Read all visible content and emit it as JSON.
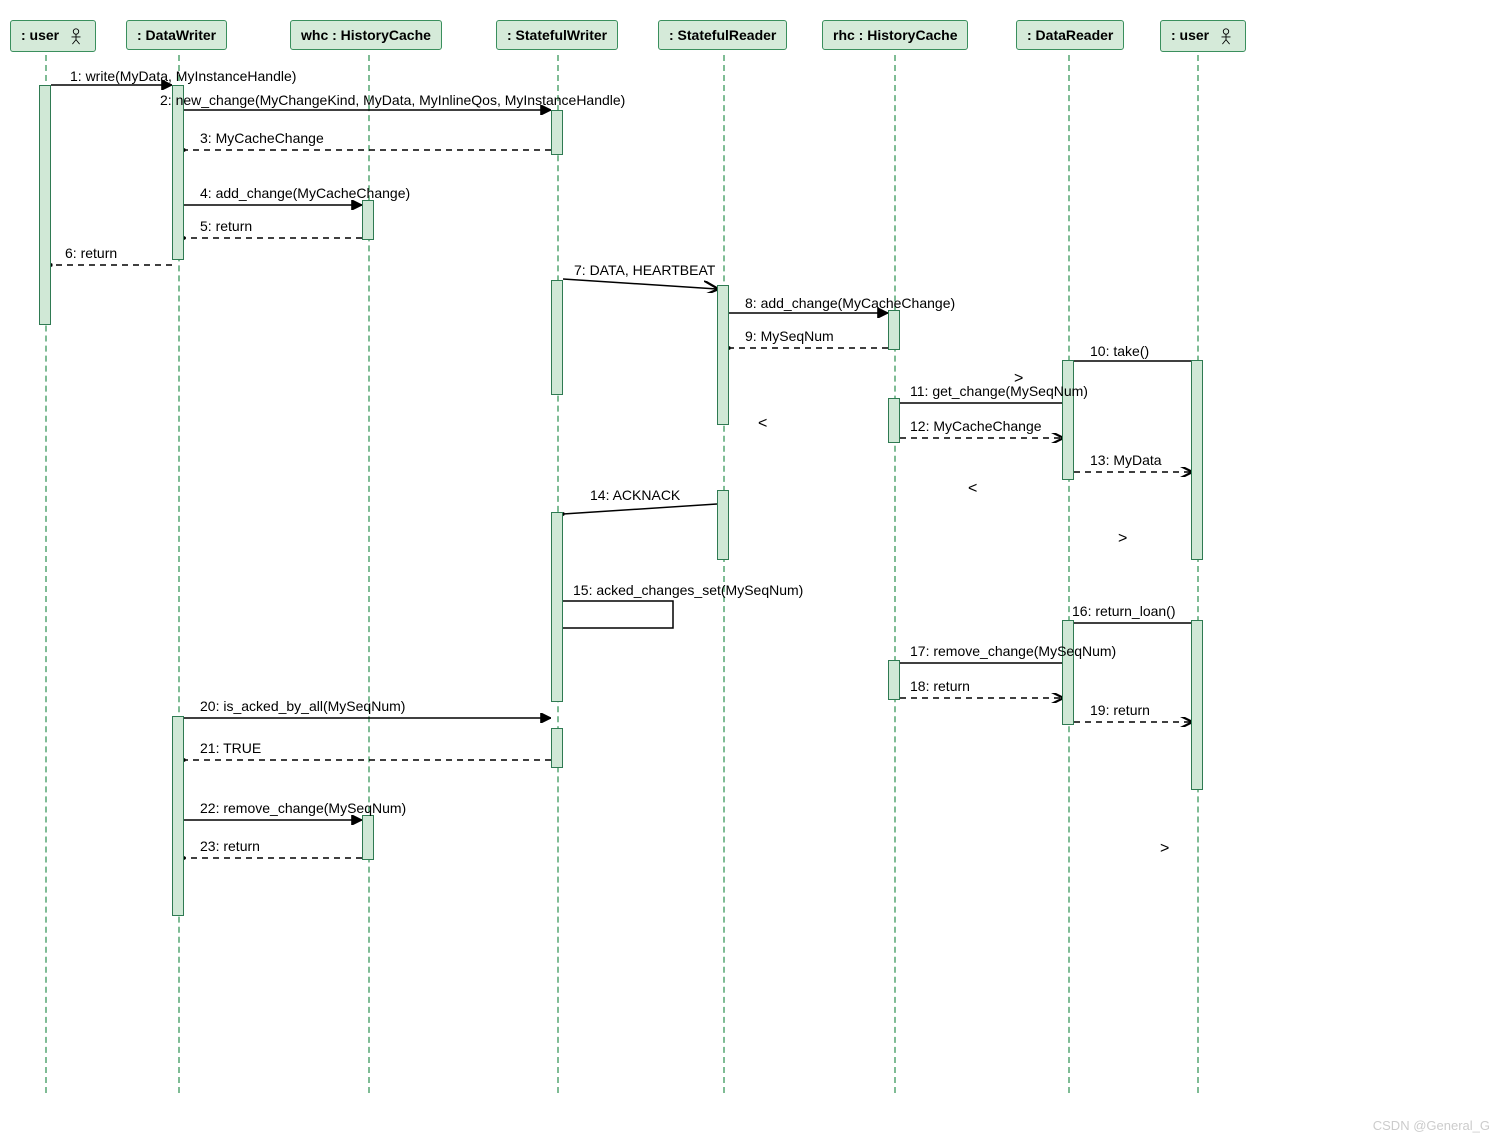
{
  "participants": {
    "user1": ": user",
    "dataWriter": ": DataWriter",
    "whc": "whc : HistoryCache",
    "statefulWriter": ": StatefulWriter",
    "statefulReader": ": StatefulReader",
    "rhc": "rhc : HistoryCache",
    "dataReader": ": DataReader",
    "user2": ": user"
  },
  "messages": {
    "m1": "1: write(MyData, MyInstanceHandle)",
    "m2": "2: new_change(MyChangeKind, MyData, MyInlineQos, MyInstanceHandle)",
    "m3": "3: MyCacheChange",
    "m4": "4: add_change(MyCacheChange)",
    "m5": "5: return",
    "m6": "6: return",
    "m7": "7: DATA, HEARTBEAT",
    "m8": "8: add_change(MyCacheChange)",
    "m9": "9: MySeqNum",
    "m10": "10: take()",
    "m11": "11: get_change(MySeqNum)",
    "m12": "12: MyCacheChange",
    "m13": "13: MyData",
    "m14": "14: ACKNACK",
    "m15": "15: acked_changes_set(MySeqNum)",
    "m16": "16: return_loan()",
    "m17": "17: remove_change(MySeqNum)",
    "m18": "18: return",
    "m19": "19: return",
    "m20": "20: is_acked_by_all(MySeqNum)",
    "m21": "21: TRUE",
    "m22": "22: remove_change(MySeqNum)",
    "m23": "23: return"
  },
  "watermark": "CSDN @General_G",
  "chart_data": {
    "type": "sequence-diagram",
    "participants": [
      {
        "id": "user1",
        "label": ": user",
        "kind": "actor"
      },
      {
        "id": "dataWriter",
        "label": ": DataWriter",
        "kind": "object"
      },
      {
        "id": "whc",
        "label": "whc : HistoryCache",
        "kind": "object"
      },
      {
        "id": "statefulWriter",
        "label": ": StatefulWriter",
        "kind": "object"
      },
      {
        "id": "statefulReader",
        "label": ": StatefulReader",
        "kind": "object"
      },
      {
        "id": "rhc",
        "label": "rhc : HistoryCache",
        "kind": "object"
      },
      {
        "id": "dataReader",
        "label": ": DataReader",
        "kind": "object"
      },
      {
        "id": "user2",
        "label": ": user",
        "kind": "actor"
      }
    ],
    "messages": [
      {
        "n": 1,
        "from": "user1",
        "to": "dataWriter",
        "label": "write(MyData, MyInstanceHandle)",
        "style": "sync"
      },
      {
        "n": 2,
        "from": "dataWriter",
        "to": "statefulWriter",
        "label": "new_change(MyChangeKind, MyData, MyInlineQos, MyInstanceHandle)",
        "style": "sync"
      },
      {
        "n": 3,
        "from": "statefulWriter",
        "to": "dataWriter",
        "label": "MyCacheChange",
        "style": "return"
      },
      {
        "n": 4,
        "from": "dataWriter",
        "to": "whc",
        "label": "add_change(MyCacheChange)",
        "style": "sync"
      },
      {
        "n": 5,
        "from": "whc",
        "to": "dataWriter",
        "label": "return",
        "style": "return"
      },
      {
        "n": 6,
        "from": "dataWriter",
        "to": "user1",
        "label": "return",
        "style": "return"
      },
      {
        "n": 7,
        "from": "statefulWriter",
        "to": "statefulReader",
        "label": "DATA, HEARTBEAT",
        "style": "async"
      },
      {
        "n": 8,
        "from": "statefulReader",
        "to": "rhc",
        "label": "add_change(MyCacheChange)",
        "style": "sync"
      },
      {
        "n": 9,
        "from": "rhc",
        "to": "statefulReader",
        "label": "MySeqNum",
        "style": "return"
      },
      {
        "n": 10,
        "from": "user2",
        "to": "dataReader",
        "label": "take()",
        "style": "sync"
      },
      {
        "n": 11,
        "from": "dataReader",
        "to": "rhc",
        "label": "get_change(MySeqNum)",
        "style": "sync"
      },
      {
        "n": 12,
        "from": "rhc",
        "to": "dataReader",
        "label": "MyCacheChange",
        "style": "return"
      },
      {
        "n": 13,
        "from": "dataReader",
        "to": "user2",
        "label": "MyData",
        "style": "return"
      },
      {
        "n": 14,
        "from": "statefulReader",
        "to": "statefulWriter",
        "label": "ACKNACK",
        "style": "async"
      },
      {
        "n": 15,
        "from": "statefulWriter",
        "to": "statefulWriter",
        "label": "acked_changes_set(MySeqNum)",
        "style": "self"
      },
      {
        "n": 16,
        "from": "user2",
        "to": "dataReader",
        "label": "return_loan()",
        "style": "sync"
      },
      {
        "n": 17,
        "from": "dataReader",
        "to": "rhc",
        "label": "remove_change(MySeqNum)",
        "style": "sync"
      },
      {
        "n": 18,
        "from": "rhc",
        "to": "dataReader",
        "label": "return",
        "style": "return"
      },
      {
        "n": 19,
        "from": "dataReader",
        "to": "user2",
        "label": "return",
        "style": "return"
      },
      {
        "n": 20,
        "from": "dataWriter",
        "to": "statefulWriter",
        "label": "is_acked_by_all(MySeqNum)",
        "style": "sync"
      },
      {
        "n": 21,
        "from": "statefulWriter",
        "to": "dataWriter",
        "label": "TRUE",
        "style": "return"
      },
      {
        "n": 22,
        "from": "dataWriter",
        "to": "whc",
        "label": "remove_change(MySeqNum)",
        "style": "sync"
      },
      {
        "n": 23,
        "from": "whc",
        "to": "dataWriter",
        "label": "return",
        "style": "return"
      }
    ]
  }
}
